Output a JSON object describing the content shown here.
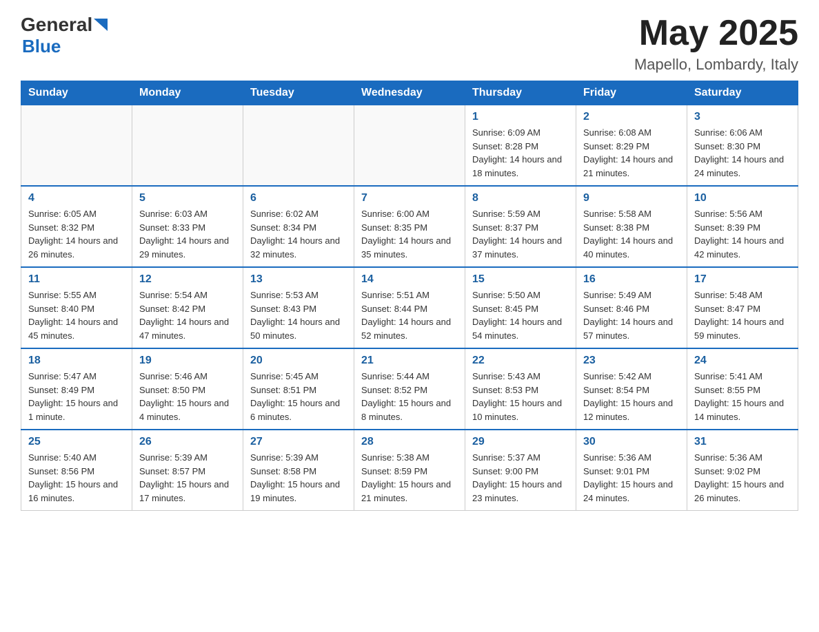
{
  "header": {
    "logo": {
      "general": "General",
      "arrow": "▶",
      "blue": "Blue"
    },
    "title": "May 2025",
    "location": "Mapello, Lombardy, Italy"
  },
  "days_of_week": [
    "Sunday",
    "Monday",
    "Tuesday",
    "Wednesday",
    "Thursday",
    "Friday",
    "Saturday"
  ],
  "weeks": [
    [
      {
        "day": "",
        "info": ""
      },
      {
        "day": "",
        "info": ""
      },
      {
        "day": "",
        "info": ""
      },
      {
        "day": "",
        "info": ""
      },
      {
        "day": "1",
        "info": "Sunrise: 6:09 AM\nSunset: 8:28 PM\nDaylight: 14 hours and 18 minutes."
      },
      {
        "day": "2",
        "info": "Sunrise: 6:08 AM\nSunset: 8:29 PM\nDaylight: 14 hours and 21 minutes."
      },
      {
        "day": "3",
        "info": "Sunrise: 6:06 AM\nSunset: 8:30 PM\nDaylight: 14 hours and 24 minutes."
      }
    ],
    [
      {
        "day": "4",
        "info": "Sunrise: 6:05 AM\nSunset: 8:32 PM\nDaylight: 14 hours and 26 minutes."
      },
      {
        "day": "5",
        "info": "Sunrise: 6:03 AM\nSunset: 8:33 PM\nDaylight: 14 hours and 29 minutes."
      },
      {
        "day": "6",
        "info": "Sunrise: 6:02 AM\nSunset: 8:34 PM\nDaylight: 14 hours and 32 minutes."
      },
      {
        "day": "7",
        "info": "Sunrise: 6:00 AM\nSunset: 8:35 PM\nDaylight: 14 hours and 35 minutes."
      },
      {
        "day": "8",
        "info": "Sunrise: 5:59 AM\nSunset: 8:37 PM\nDaylight: 14 hours and 37 minutes."
      },
      {
        "day": "9",
        "info": "Sunrise: 5:58 AM\nSunset: 8:38 PM\nDaylight: 14 hours and 40 minutes."
      },
      {
        "day": "10",
        "info": "Sunrise: 5:56 AM\nSunset: 8:39 PM\nDaylight: 14 hours and 42 minutes."
      }
    ],
    [
      {
        "day": "11",
        "info": "Sunrise: 5:55 AM\nSunset: 8:40 PM\nDaylight: 14 hours and 45 minutes."
      },
      {
        "day": "12",
        "info": "Sunrise: 5:54 AM\nSunset: 8:42 PM\nDaylight: 14 hours and 47 minutes."
      },
      {
        "day": "13",
        "info": "Sunrise: 5:53 AM\nSunset: 8:43 PM\nDaylight: 14 hours and 50 minutes."
      },
      {
        "day": "14",
        "info": "Sunrise: 5:51 AM\nSunset: 8:44 PM\nDaylight: 14 hours and 52 minutes."
      },
      {
        "day": "15",
        "info": "Sunrise: 5:50 AM\nSunset: 8:45 PM\nDaylight: 14 hours and 54 minutes."
      },
      {
        "day": "16",
        "info": "Sunrise: 5:49 AM\nSunset: 8:46 PM\nDaylight: 14 hours and 57 minutes."
      },
      {
        "day": "17",
        "info": "Sunrise: 5:48 AM\nSunset: 8:47 PM\nDaylight: 14 hours and 59 minutes."
      }
    ],
    [
      {
        "day": "18",
        "info": "Sunrise: 5:47 AM\nSunset: 8:49 PM\nDaylight: 15 hours and 1 minute."
      },
      {
        "day": "19",
        "info": "Sunrise: 5:46 AM\nSunset: 8:50 PM\nDaylight: 15 hours and 4 minutes."
      },
      {
        "day": "20",
        "info": "Sunrise: 5:45 AM\nSunset: 8:51 PM\nDaylight: 15 hours and 6 minutes."
      },
      {
        "day": "21",
        "info": "Sunrise: 5:44 AM\nSunset: 8:52 PM\nDaylight: 15 hours and 8 minutes."
      },
      {
        "day": "22",
        "info": "Sunrise: 5:43 AM\nSunset: 8:53 PM\nDaylight: 15 hours and 10 minutes."
      },
      {
        "day": "23",
        "info": "Sunrise: 5:42 AM\nSunset: 8:54 PM\nDaylight: 15 hours and 12 minutes."
      },
      {
        "day": "24",
        "info": "Sunrise: 5:41 AM\nSunset: 8:55 PM\nDaylight: 15 hours and 14 minutes."
      }
    ],
    [
      {
        "day": "25",
        "info": "Sunrise: 5:40 AM\nSunset: 8:56 PM\nDaylight: 15 hours and 16 minutes."
      },
      {
        "day": "26",
        "info": "Sunrise: 5:39 AM\nSunset: 8:57 PM\nDaylight: 15 hours and 17 minutes."
      },
      {
        "day": "27",
        "info": "Sunrise: 5:39 AM\nSunset: 8:58 PM\nDaylight: 15 hours and 19 minutes."
      },
      {
        "day": "28",
        "info": "Sunrise: 5:38 AM\nSunset: 8:59 PM\nDaylight: 15 hours and 21 minutes."
      },
      {
        "day": "29",
        "info": "Sunrise: 5:37 AM\nSunset: 9:00 PM\nDaylight: 15 hours and 23 minutes."
      },
      {
        "day": "30",
        "info": "Sunrise: 5:36 AM\nSunset: 9:01 PM\nDaylight: 15 hours and 24 minutes."
      },
      {
        "day": "31",
        "info": "Sunrise: 5:36 AM\nSunset: 9:02 PM\nDaylight: 15 hours and 26 minutes."
      }
    ]
  ]
}
